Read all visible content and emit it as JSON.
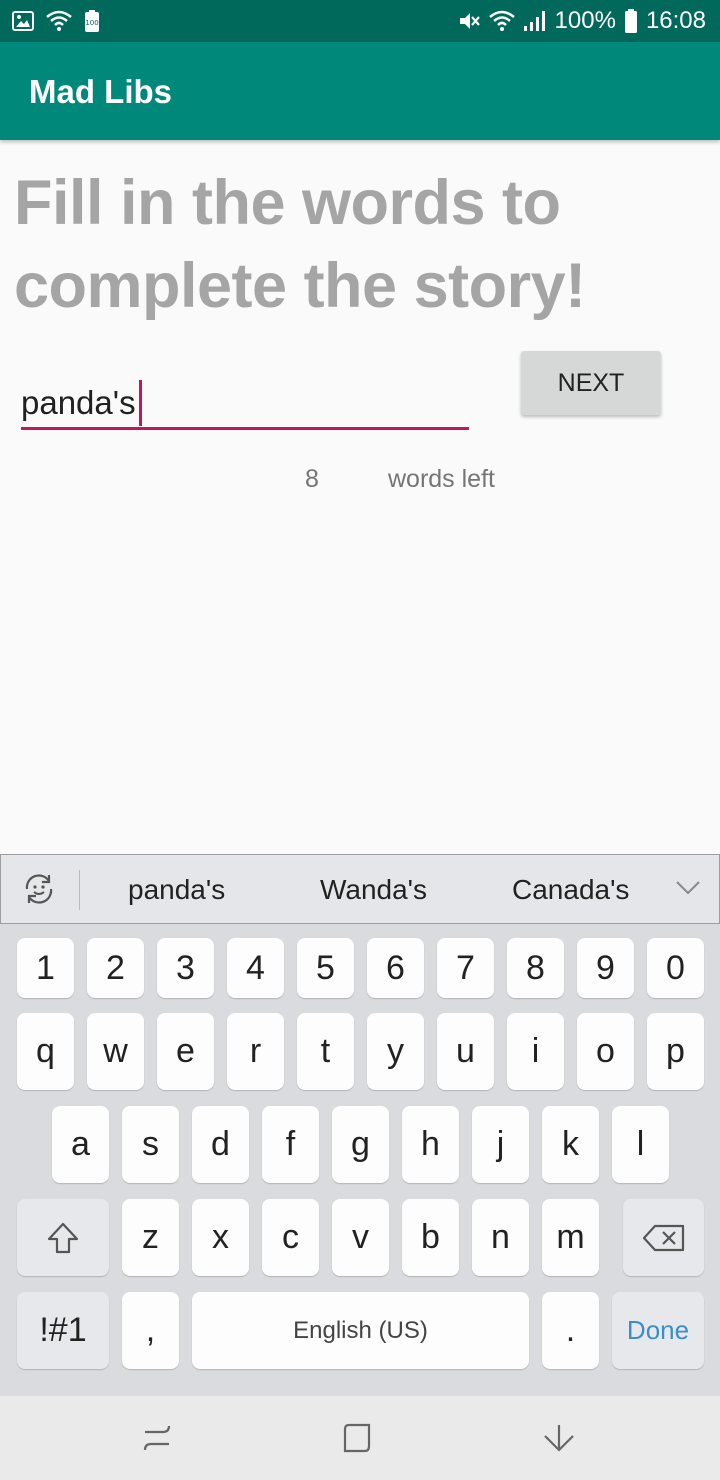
{
  "status_bar": {
    "battery_percent": "100%",
    "time": "16:08",
    "battery_badge": "100",
    "icons": [
      "image-icon",
      "wifi-icon",
      "battery-saver-icon",
      "mute-icon",
      "wifi-icon",
      "signal-icon",
      "battery-icon"
    ]
  },
  "app": {
    "title": "Mad Libs"
  },
  "main": {
    "heading": "Fill in the words to complete the story!",
    "input_value": "panda's",
    "next_label": "NEXT",
    "words_left_count": "8",
    "words_left_label": "words left"
  },
  "keyboard": {
    "suggestions": [
      "panda's",
      "Wanda's",
      "Canada's"
    ],
    "row_numbers": [
      "1",
      "2",
      "3",
      "4",
      "5",
      "6",
      "7",
      "8",
      "9",
      "0"
    ],
    "row_top": [
      "q",
      "w",
      "e",
      "r",
      "t",
      "y",
      "u",
      "i",
      "o",
      "p"
    ],
    "row_middle": [
      "a",
      "s",
      "d",
      "f",
      "g",
      "h",
      "j",
      "k",
      "l"
    ],
    "row_bottom": [
      "z",
      "x",
      "c",
      "v",
      "b",
      "n",
      "m"
    ],
    "symbols_label": "!#1",
    "comma_label": ",",
    "space_label": "English (US)",
    "period_label": ".",
    "done_label": "Done",
    "accent_color": "#3a8fc9"
  },
  "colors": {
    "status_bar": "#00695c",
    "app_bar": "#00897b",
    "input_underline": "#c2185b",
    "heading": "#a5a5a5"
  }
}
